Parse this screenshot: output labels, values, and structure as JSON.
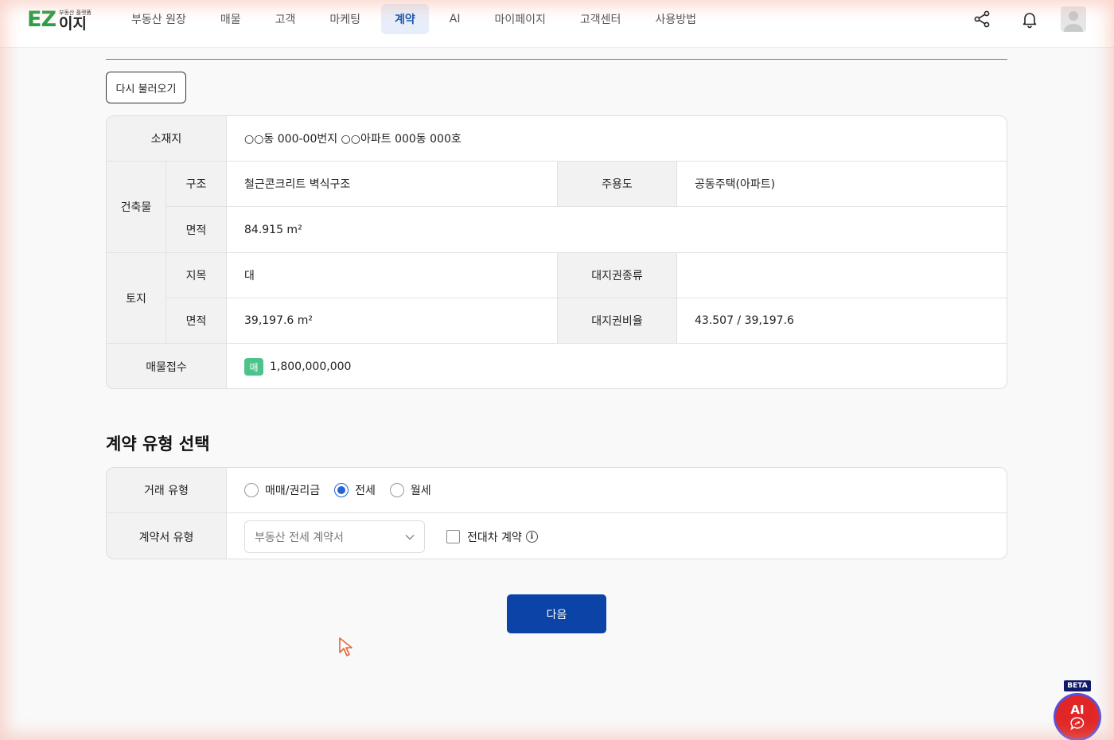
{
  "header": {
    "logo": {
      "ez": "EZ",
      "subtitle": "부동산 플랫폼",
      "korean": "이지"
    },
    "nav": [
      {
        "label": "부동산 원장",
        "active": false
      },
      {
        "label": "매물",
        "active": false
      },
      {
        "label": "고객",
        "active": false
      },
      {
        "label": "마케팅",
        "active": false
      },
      {
        "label": "계약",
        "active": true
      },
      {
        "label": "AI",
        "active": false
      },
      {
        "label": "마이페이지",
        "active": false
      },
      {
        "label": "고객센터",
        "active": false
      },
      {
        "label": "사용방법",
        "active": false
      }
    ],
    "icons": {
      "share": "share-icon",
      "notifications": "bell-icon",
      "profile": "avatar-icon"
    }
  },
  "reload_button": "다시 불러오기",
  "property": {
    "location_label": "소재지",
    "location": "○○동 000-00번지 ○○아파트 000동 000호",
    "building_label": "건축물",
    "structure_label": "구조",
    "structure": "철근콘크리트 벽식구조",
    "usage_label": "주용도",
    "usage": "공동주택(아파트)",
    "building_area_label": "면적",
    "building_area": "84.915 m²",
    "land_label": "토지",
    "land_category_label": "지목",
    "land_category": "대",
    "land_right_type_label": "대지권종류",
    "land_right_type": "",
    "land_area_label": "면적",
    "land_area": "39,197.6 m²",
    "land_right_ratio_label": "대지권비율",
    "land_right_ratio": "43.507 / 39,197.6",
    "listing_label": "매물접수",
    "listing_badge": "매",
    "listing_price": "1,800,000,000"
  },
  "contract_type": {
    "title": "계약 유형 선택",
    "deal_type_label": "거래 유형",
    "deal_options": [
      {
        "label": "매매/권리금",
        "selected": false
      },
      {
        "label": "전세",
        "selected": true
      },
      {
        "label": "월세",
        "selected": false
      }
    ],
    "doc_type_label": "계약서 유형",
    "doc_type_value": "부동산 전세 계약서",
    "sublease_label": "전대차 계약",
    "sublease_checked": false,
    "info_glyph": "i"
  },
  "next_button": "다음",
  "ai_widget": {
    "beta": "BETA",
    "label": "AI"
  },
  "colors": {
    "primary": "#0b44a6",
    "accent": "#1a55b5",
    "badge": "#4cc38a",
    "ai": "#e02626"
  }
}
